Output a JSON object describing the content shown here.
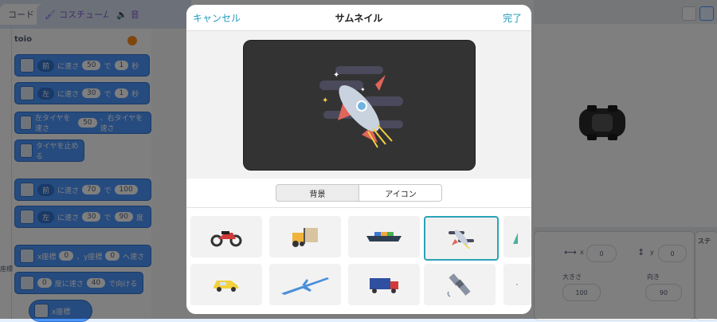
{
  "background": {
    "tabs": [
      {
        "label": "コード"
      },
      {
        "label": "コスチューム"
      },
      {
        "label": "音"
      }
    ],
    "category_title": "toio",
    "blocks": [
      {
        "parts": [
          "前",
          "に速さ",
          "50",
          "で",
          "1",
          "秒"
        ]
      },
      {
        "parts": [
          "左",
          "に速さ",
          "30",
          "で",
          "1",
          "秒"
        ]
      },
      {
        "parts": [
          "左タイヤを速さ",
          "50",
          "、右タイヤを速さ"
        ]
      },
      {
        "parts": [
          "タイヤを止める"
        ]
      },
      {
        "parts": [
          "前",
          "に速さ",
          "70",
          "で",
          "100"
        ]
      },
      {
        "parts": [
          "左",
          "に速さ",
          "30",
          "で",
          "90",
          "度"
        ]
      },
      {
        "parts": [
          "x座標",
          "0",
          "、y座標",
          "0",
          "へ速さ"
        ]
      },
      {
        "parts": [
          "0",
          "度に速さ",
          "40",
          "で向ける"
        ]
      },
      {
        "parts": [
          "x座標"
        ]
      }
    ],
    "side_label": "座標",
    "sprite_panel": {
      "x_label": "x",
      "x_value": "0",
      "y_label": "y",
      "y_value": "0",
      "size_label": "大きさ",
      "size_value": "100",
      "direction_label": "向き",
      "direction_value": "90"
    },
    "stage_panel_label": "ステ"
  },
  "modal": {
    "cancel_label": "キャンセル",
    "title": "サムネイル",
    "done_label": "完了",
    "segments": [
      {
        "label": "背景",
        "selected": false
      },
      {
        "label": "アイコン",
        "selected": true
      }
    ],
    "icons": [
      {
        "name": "motorcycle-icon",
        "selected": false
      },
      {
        "name": "forklift-icon",
        "selected": false
      },
      {
        "name": "cargo-ship-icon",
        "selected": false
      },
      {
        "name": "rocket-icon",
        "selected": true
      },
      {
        "name": "partial-icon",
        "selected": false
      },
      {
        "name": "car-icon",
        "selected": false
      },
      {
        "name": "airplane-icon",
        "selected": false
      },
      {
        "name": "truck-icon",
        "selected": false
      },
      {
        "name": "satellite-icon",
        "selected": false
      },
      {
        "name": "partial-icon",
        "selected": false
      }
    ],
    "accent_color": "#1e9bbd",
    "selected_border_color": "#2aa3b8"
  }
}
